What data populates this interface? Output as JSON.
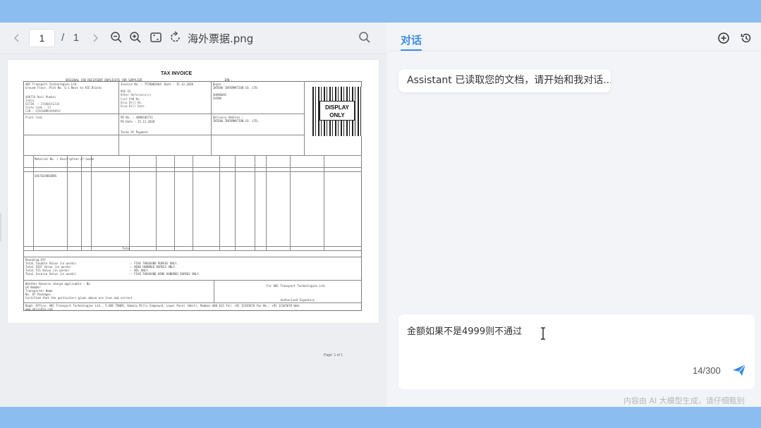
{
  "viewer": {
    "current_page": "1",
    "page_separator": "/",
    "total_pages": "1",
    "file_name": "海外票据.png",
    "footer": "Page: 1 of 1"
  },
  "invoice": {
    "title": "TAX INVOICE",
    "display_only": [
      "DISPLAY",
      "ONLY"
    ],
    "copy_flags": "ORIGINAL FOR RECIPIENT   DUPLICATE FOR SUPPLIER",
    "irn": "IRN :",
    "seller": "ABC Transport Technologies Ltd",
    "seller_addr": "Ground Floor, Plot No. G-1 Next to ACE Blocks",
    "invoice_no": "Invoice No. : 7578802664",
    "invoice_date": "Date : 15.12.2020",
    "buyer": "Buyer :",
    "buyer_name": "INTEHU INFORMATION CO. LTD.",
    "buyer_city": "SHANGHAI",
    "buyer_country": "CHINA",
    "delivery": "Delivery Address :",
    "po_no": "PO No. : 4000102731",
    "po_date": "PO Date : 25.11.2020",
    "terms": "Terms Of Payment",
    "rows_label": "Material No. / Description of Goods",
    "item": "SAG762X003BRS",
    "total_label": "Total",
    "rounding": "Rounding Off",
    "total_taxable": "Total Taxable Value (in words)",
    "total_igst": "Total IGST Value (in words)",
    "total_tcs": "Total TCS Value (in words)",
    "total_invoice": "Total Invoice Value (in words)",
    "words_1": ":- FIVE THOUSAND RUPEES ONLY.",
    "words_2": ":- NINE HUNDRED RUPEES ONLY.",
    "words_3": ":- NIL ONLY.",
    "words_4": ":- FIVE THOUSAND NINE HUNDRED RUPEES ONLY.",
    "reverse": "Whether Reverse charge applicable : No",
    "lr_no": "LR Number",
    "transporter": "Transporter Name",
    "packages": "No. Of Packages",
    "certified": "Certified that the particulars given above are true and correct",
    "for_company": "For ABC Transport Technologies Ltd.",
    "signatory": "Authorised Signatory",
    "reg_office": "Regd. Office: ABC Transport Technologies Ltd., 5,ABC TOWER, Kamala Mills Compound, Lower Parel (West), Mumbai-400 013 Tel: +91 12345678   Fax No.: +91 12345678  Web:",
    "web": "www.abcindia.com"
  },
  "chat": {
    "tab_label": "对话",
    "assistant_message": "Assistant 已读取您的文档，请开始和我对话...",
    "input_value": "金额如果不是4999则不通过",
    "counter": "14/300",
    "disclaimer": "内容由 AI 大模型生成，请仔细甄别"
  },
  "icons": {
    "prev_page": "chevron-left-icon",
    "next_page": "chevron-right-icon",
    "zoom_out": "zoom-out-icon",
    "zoom_in": "zoom-in-icon",
    "fit": "fit-screen-icon",
    "rotate": "rotate-icon",
    "search": "search-icon",
    "new_chat": "add-circle-icon",
    "history": "history-icon",
    "send": "send-icon"
  },
  "colors": {
    "accent": "#3b8de6",
    "frame": "#8cbdf0"
  }
}
